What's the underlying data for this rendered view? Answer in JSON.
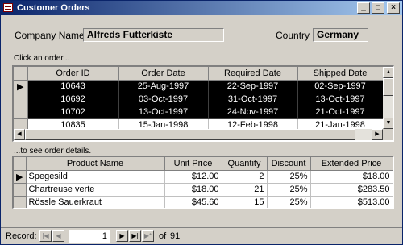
{
  "window": {
    "title": "Customer Orders",
    "minimize_glyph": "_",
    "maximize_glyph": "□",
    "close_glyph": "×"
  },
  "customer": {
    "company_label": "Company Name",
    "company_value": "Alfreds Futterkiste",
    "country_label": "Country",
    "country_value": "Germany"
  },
  "orders": {
    "hint": "Click an order...",
    "columns": [
      "Order ID",
      "Order Date",
      "Required Date",
      "Shipped Date"
    ],
    "rows": [
      [
        "10643",
        "25-Aug-1997",
        "22-Sep-1997",
        "02-Sep-1997"
      ],
      [
        "10692",
        "03-Oct-1997",
        "31-Oct-1997",
        "13-Oct-1997"
      ],
      [
        "10702",
        "13-Oct-1997",
        "24-Nov-1997",
        "21-Oct-1997"
      ],
      [
        "10835",
        "15-Jan-1998",
        "12-Feb-1998",
        "21-Jan-1998"
      ]
    ]
  },
  "details": {
    "hint": "...to see order details.",
    "columns": [
      "Product Name",
      "Unit Price",
      "Quantity",
      "Discount",
      "Extended Price"
    ],
    "rows": [
      [
        "Spegesild",
        "$12.00",
        "2",
        "25%",
        "$18.00"
      ],
      [
        "Chartreuse verte",
        "$18.00",
        "21",
        "25%",
        "$283.50"
      ],
      [
        "Rössle Sauerkraut",
        "$45.60",
        "15",
        "25%",
        "$513.00"
      ]
    ]
  },
  "navigation": {
    "record_label": "Record:",
    "current_record": "1",
    "of_label": "of",
    "total_records": "91"
  },
  "icons": {
    "current-record": "right-pointing-triangle",
    "first": "first-record",
    "prev": "previous-record",
    "next": "next-record",
    "last": "last-record",
    "new": "new-record"
  }
}
